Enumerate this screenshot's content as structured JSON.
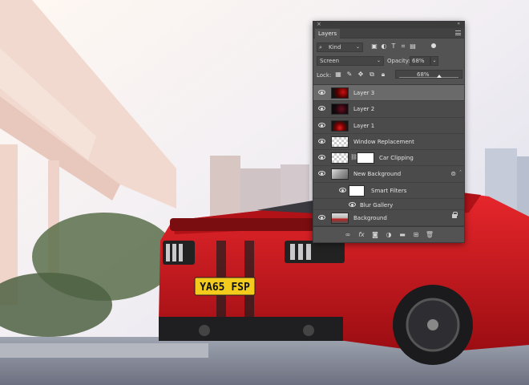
{
  "panel": {
    "tab_label": "Layers",
    "filter": {
      "label": "Kind",
      "icons": [
        "image-filter-icon",
        "adjustment-filter-icon",
        "type-filter-icon",
        "shape-filter-icon",
        "smart-object-filter-icon"
      ]
    },
    "blend_mode": "Screen",
    "opacity_label": "Opacity:",
    "opacity_value": "68%",
    "lock_label": "Lock:",
    "fill_value": "68%",
    "fill_level": 0.68,
    "layers": [
      {
        "name": "Layer 3",
        "selected": true
      },
      {
        "name": "Layer 2"
      },
      {
        "name": "Layer 1"
      },
      {
        "name": "Window Replacement"
      },
      {
        "name": "Car Clipping"
      },
      {
        "name": "New Background"
      },
      {
        "name": "Smart Filters"
      },
      {
        "name": "Blur Gallery"
      },
      {
        "name": "Background"
      }
    ],
    "footer_icons": [
      "link-icon",
      "fx-icon",
      "mask-icon",
      "adjustment-icon",
      "folder-icon",
      "new-layer-icon",
      "trash-icon"
    ]
  },
  "scene": {
    "plate_text": "YA65 FSP",
    "colors": {
      "car_red": "#c8161c",
      "sky": "#f2eef2",
      "panel_bg": "#535353"
    }
  }
}
